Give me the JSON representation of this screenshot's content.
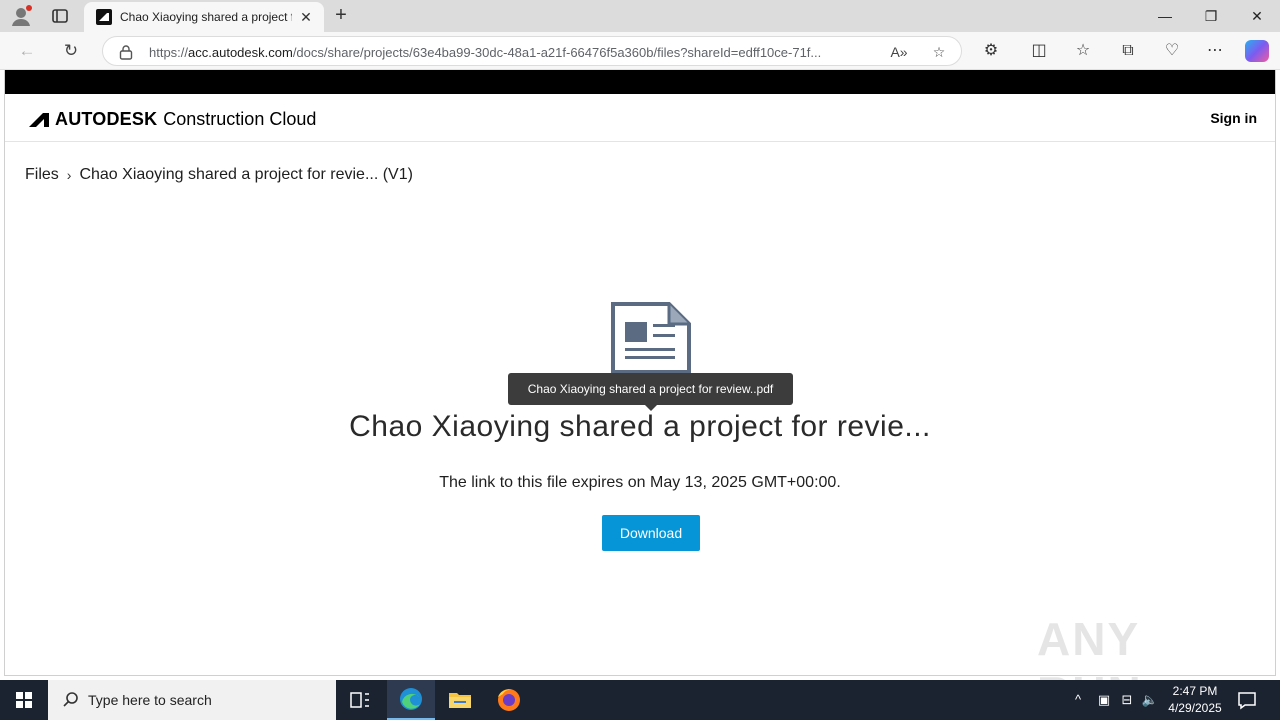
{
  "browser": {
    "tab_title": "Chao Xiaoying shared a project f",
    "tab_close": "✕",
    "new_tab": "+",
    "url_prefix": "https://",
    "url_host": "acc.autodesk.com",
    "url_path": "/docs/share/projects/63e4ba99-30dc-48a1-a21f-66476f5a360b/files?shareId=edff10ce-71f...",
    "window_minimize": "—",
    "window_restore": "❐",
    "window_close": "✕"
  },
  "header": {
    "brand": "AUTODESK",
    "product": "Construction Cloud",
    "sign_in": "Sign in"
  },
  "breadcrumb": {
    "root": "Files",
    "separator": "›",
    "current": "Chao Xiaoying shared a project for revie...  (V1)"
  },
  "file": {
    "tooltip": "Chao Xiaoying shared a project for review..pdf",
    "name": "Chao Xiaoying shared a project for revie...",
    "expires": "The link to this file expires on May 13, 2025 GMT+00:00.",
    "download_label": "Download"
  },
  "watermark": "ANY RUN",
  "taskbar": {
    "search_placeholder": "Type here to search",
    "time": "2:47 PM",
    "date": "4/29/2025"
  },
  "colors": {
    "accent": "#0696d7",
    "doc_icon": "#5b6b82",
    "taskbar": "#1c2330"
  }
}
